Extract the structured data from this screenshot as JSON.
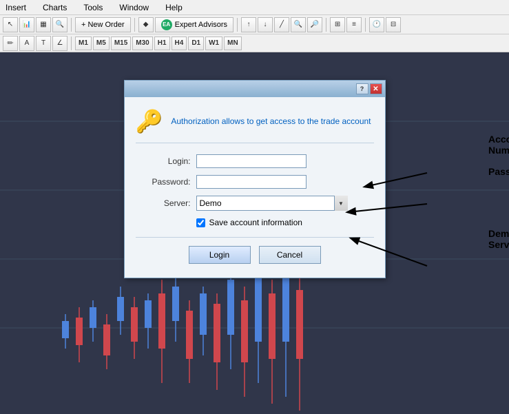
{
  "menu": {
    "items": [
      "Insert",
      "Charts",
      "Tools",
      "Window",
      "Help"
    ]
  },
  "toolbar1": {
    "new_order_label": "New Order",
    "expert_advisors_label": "Expert Advisors"
  },
  "toolbar2": {
    "timeframes": [
      "M1",
      "M5",
      "M15",
      "M30",
      "H1",
      "H4",
      "D1",
      "W1",
      "MN"
    ]
  },
  "dialog": {
    "title": "",
    "help_btn": "?",
    "close_btn": "✕",
    "description": "Authorization allows to get access to the trade account",
    "login_label": "Login:",
    "password_label": "Password:",
    "server_label": "Server:",
    "server_value": "Demo",
    "save_label": "Save account information",
    "login_btn": "Login",
    "cancel_btn": "Cancel"
  },
  "annotations": {
    "account_number": "Account Number",
    "password": "Password",
    "demo_server": "Demo Server"
  }
}
